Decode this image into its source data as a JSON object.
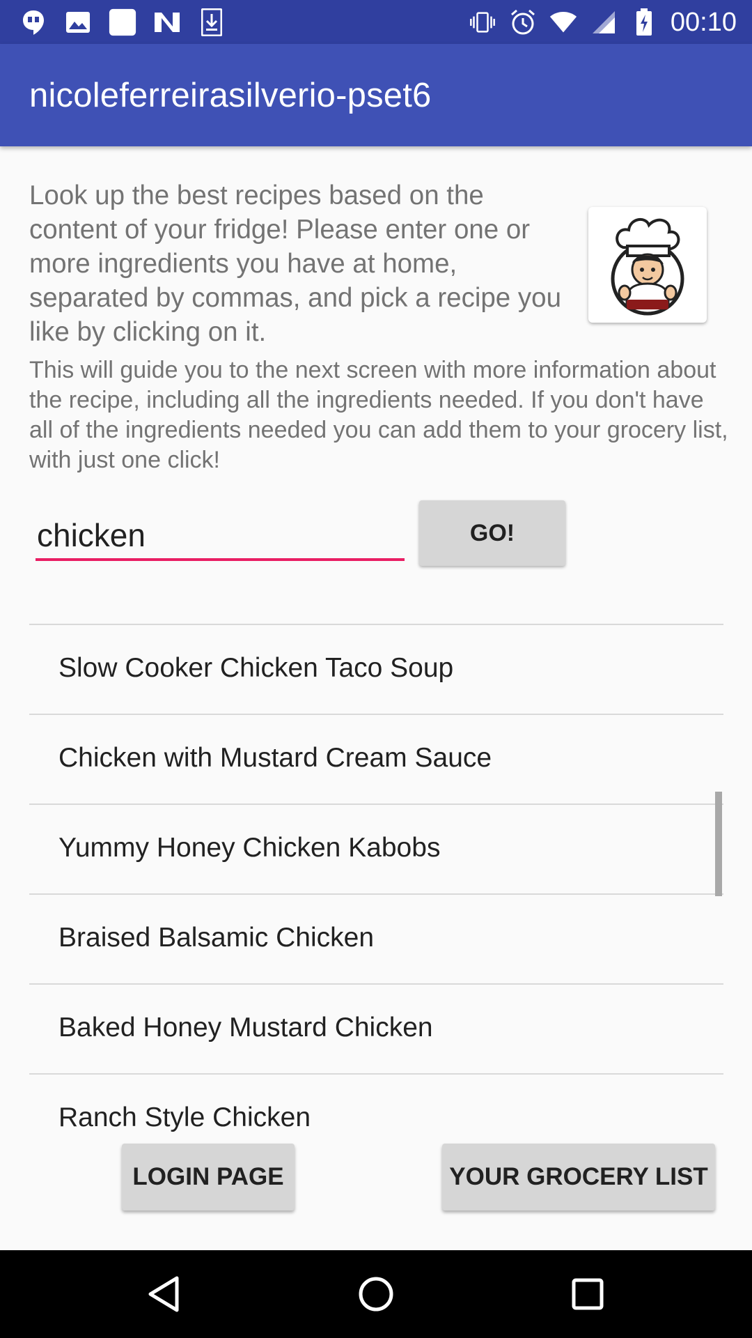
{
  "status_bar": {
    "time": "00:10",
    "left_icons": [
      "hangouts-icon",
      "image-icon",
      "square-icon",
      "n-icon",
      "download-icon"
    ],
    "right_icons": [
      "vibrate-icon",
      "alarm-icon",
      "wifi-icon",
      "signal-icon",
      "battery-charging-icon"
    ]
  },
  "app_bar": {
    "title": "nicoleferreirasilverio-pset6",
    "color": "#3f51b5"
  },
  "intro": {
    "text": "Look up the best recipes based on the content of your fridge! Please enter one or more ingredients you have at home, separated by commas, and pick a recipe you like by clicking on it.",
    "text2": "This will guide you to the next screen with more information about the recipe, including all the ingredients needed. If you don't have all of the ingredients needed you can add them to your grocery list, with just one click!"
  },
  "search": {
    "value": "chicken",
    "go_label": "GO!",
    "accent": "#e91e63"
  },
  "recipes": [
    "Slow Cooker Chicken Taco Soup",
    "Chicken with Mustard Cream Sauce",
    "Yummy Honey Chicken Kabobs",
    "Braised Balsamic Chicken",
    "Baked Honey Mustard Chicken",
    "Ranch Style Chicken"
  ],
  "buttons": {
    "login": "LOGIN PAGE",
    "grocery": "YOUR GROCERY LIST"
  },
  "nav": {
    "icons": [
      "back-icon",
      "home-icon",
      "recents-icon"
    ]
  }
}
